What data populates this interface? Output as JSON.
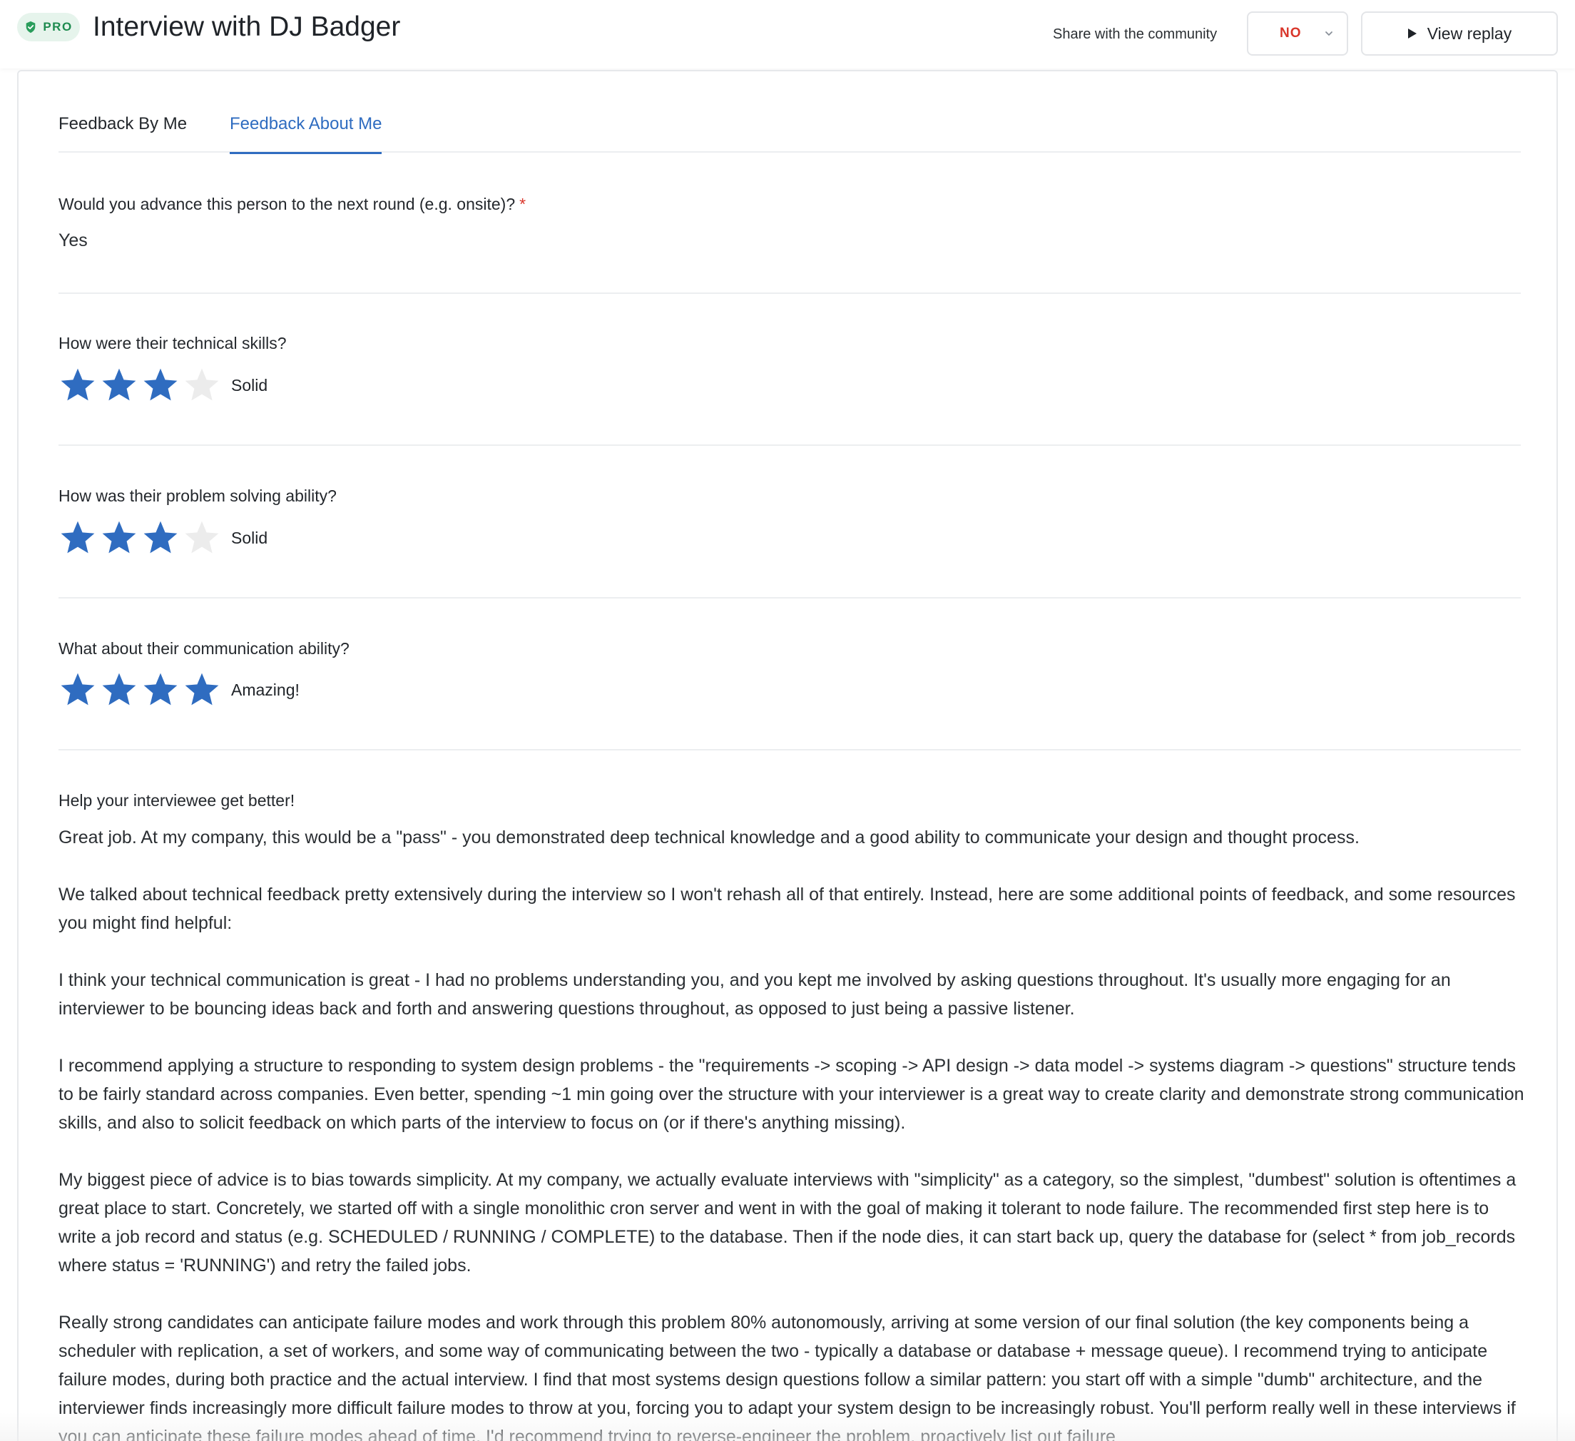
{
  "header": {
    "badge_label": "PRO",
    "title": "Interview with DJ Badger",
    "share_label": "Share with the community",
    "share_value": "NO",
    "replay_label": "View replay"
  },
  "tabs": [
    {
      "label": "Feedback By Me",
      "active": false
    },
    {
      "label": "Feedback About Me",
      "active": true
    }
  ],
  "questions": {
    "advance": {
      "label": "Would you advance this person to the next round (e.g. onsite)?",
      "required_mark": "*",
      "answer": "Yes"
    },
    "technical": {
      "label": "How were their technical skills?",
      "rating": 3,
      "max": 4,
      "rating_label": "Solid"
    },
    "problem_solving": {
      "label": "How was their problem solving ability?",
      "rating": 3,
      "max": 4,
      "rating_label": "Solid"
    },
    "communication": {
      "label": "What about their communication ability?",
      "rating": 4,
      "max": 4,
      "rating_label": "Amazing!"
    }
  },
  "feedback": {
    "label": "Help your interviewee get better!",
    "paragraphs": [
      "Great job. At my company, this would be a \"pass\" - you demonstrated deep technical knowledge and a good ability to communicate your design and thought process.",
      "We talked about technical feedback pretty extensively during the interview so I won't rehash all of that entirely. Instead, here are some additional points of feedback, and some resources you might find helpful:",
      "I think your technical communication is great - I had no problems understanding you, and you kept me involved by asking questions throughout. It's usually more engaging for an interviewer to be bouncing ideas back and forth and answering questions throughout, as opposed to just being a passive listener.",
      "I recommend applying a structure to responding to system design problems - the \"requirements -> scoping -> API design -> data model -> systems diagram -> questions\" structure tends to be fairly standard across companies. Even better, spending ~1 min going over the structure with your interviewer is a great way to create clarity and demonstrate strong communication skills, and also to solicit feedback on which parts of the interview to focus on (or if there's anything missing).",
      "My biggest piece of advice is to bias towards simplicity. At my company, we actually evaluate interviews with \"simplicity\" as a category, so the simplest, \"dumbest\" solution is oftentimes a great place to start. Concretely, we started off with a single monolithic cron server and went in with the goal of making it tolerant to node failure. The recommended first step here is to write a job record and status (e.g. SCHEDULED / RUNNING / COMPLETE) to the database. Then if the node dies, it can start back up, query the database for (select * from job_records where status = 'RUNNING') and retry the failed jobs.",
      "Really strong candidates can anticipate failure modes and work through this problem 80% autonomously, arriving at some version of our final solution (the key components being a scheduler with replication, a set of workers, and some way of communicating between the two - typically a database or database + message queue). I recommend trying to anticipate failure modes, during both practice and the actual interview. I find that most systems design questions follow a similar pattern: you start off with a simple \"dumb\" architecture, and the interviewer finds increasingly more difficult failure modes to throw at you, forcing you to adapt your system design to be increasingly robust. You'll perform really well in these interviews if you can anticipate these failure modes ahead of time. I'd recommend trying to reverse-engineer the problem, proactively list out failure"
    ]
  },
  "colors": {
    "accent": "#2f6cc0",
    "star_filled": "#2f6cc0",
    "star_empty": "#ececec",
    "danger": "#d9362b",
    "pro_green": "#1e8b4f",
    "pro_bg": "#e6f4ec"
  },
  "icons": {
    "badge": "shield-check-icon",
    "dropdown": "chevron-down-icon",
    "replay": "play-icon",
    "rating": "star-icon"
  }
}
